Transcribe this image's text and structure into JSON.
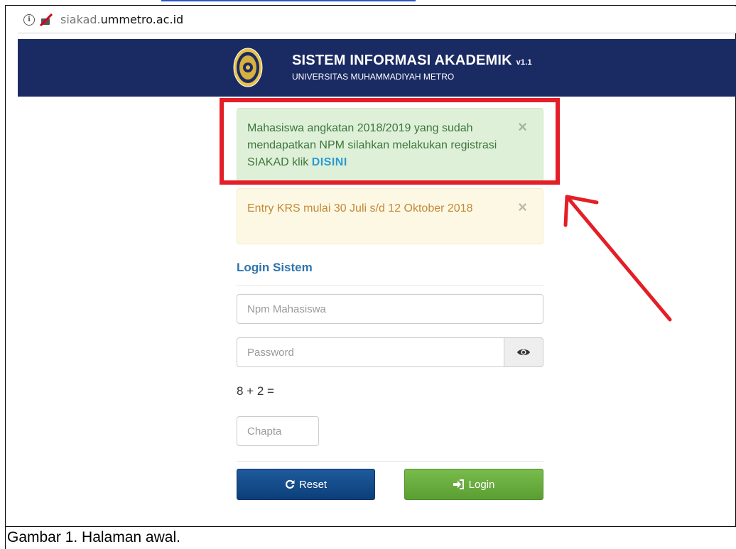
{
  "browser": {
    "url_subdomain": "siakad.",
    "url_domain": "ummetro.ac.id",
    "info_icon": "info-icon",
    "security_icon": "blocked-icon"
  },
  "header": {
    "title": "SISTEM INFORMASI AKADEMIK",
    "version": "v1.1",
    "subtitle": "UNIVERSITAS MUHAMMADIYAH METRO",
    "background_color": "#1a2a63"
  },
  "alerts": {
    "success": {
      "text": "Mahasiswa angkatan 2018/2019 yang sudah mendapatkan NPM silahkan melakukan registrasi SIAKAD klik ",
      "link": "DISINI",
      "close": "×"
    },
    "warning": {
      "text": "Entry KRS mulai 30 Juli s/d 12 Oktober 2018",
      "close": "×"
    }
  },
  "login": {
    "title": "Login Sistem",
    "npm_placeholder": "Npm Mahasiswa",
    "password_placeholder": "Password",
    "captcha_question": "8 + 2 =",
    "captcha_placeholder": "Chapta",
    "reset_label": "Reset",
    "login_label": "Login"
  },
  "annotation": {
    "highlight_color": "#e41e26"
  },
  "caption": "Gambar 1. Halaman awal."
}
